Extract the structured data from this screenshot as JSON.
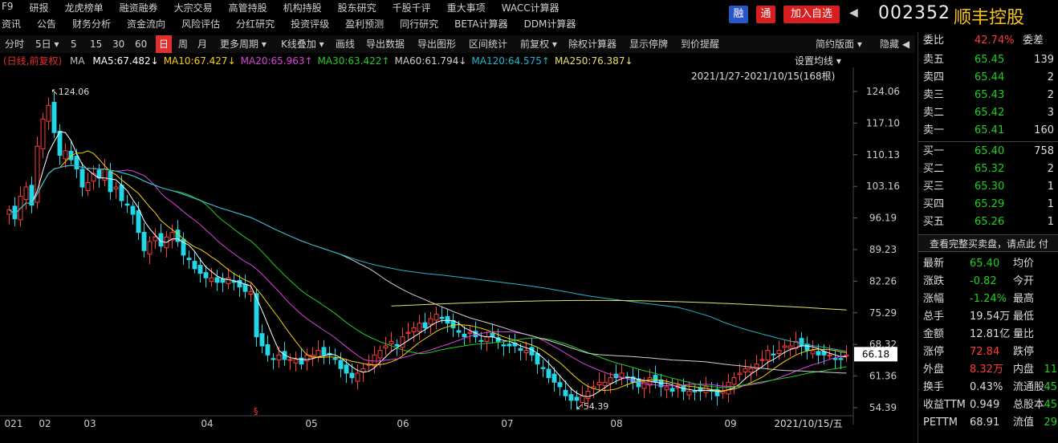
{
  "topnav": {
    "row1": [
      "F9",
      "研报",
      "龙虎榜单",
      "融资融券",
      "大宗交易",
      "高管持股",
      "机构持股",
      "股东研究",
      "千股千评",
      "重大事项",
      "WACC计算器"
    ],
    "row2": [
      "资讯",
      "公告",
      "财务分析",
      "资金流向",
      "风险评估",
      "分红研究",
      "投资评级",
      "盈利预测",
      "同行研究",
      "BETA计算器",
      "DDM计算器"
    ]
  },
  "header": {
    "btn_rong": "融",
    "btn_tong": "通",
    "btn_add": "加入自选",
    "arrow": "◀",
    "code": "002352",
    "name": "顺丰控股",
    "colors": {
      "rong": "#2a55c8",
      "tong": "#d81e1e",
      "add": "#d81e1e",
      "name": "#f5c518"
    }
  },
  "toolbar": {
    "items": [
      "分时",
      "5日 ▾",
      "5",
      "15",
      "30",
      "60",
      "日",
      "周",
      "月",
      "更多周期 ▾",
      "K线叠加 ▾",
      "画线",
      "导出数据",
      "导出图形",
      "区间统计",
      "前复权 ▾",
      "除权计算器",
      "显示停牌",
      "到价提醒",
      "简约版面 ▾",
      "隐藏 ◀"
    ],
    "active": "日"
  },
  "ma_legend": {
    "label": "(日线,前复权)",
    "ma": "MA",
    "items": [
      {
        "text": "MA5:67.482↓",
        "color": "#ffffff"
      },
      {
        "text": "MA10:67.427↓",
        "color": "#f5d200"
      },
      {
        "text": "MA20:65.963↑",
        "color": "#e040e0"
      },
      {
        "text": "MA30:63.422↑",
        "color": "#22cc22"
      },
      {
        "text": "MA60:61.794↓",
        "color": "#d0d0d0"
      },
      {
        "text": "MA120:64.575↑",
        "color": "#21b5d0"
      },
      {
        "text": "MA250:76.387↓",
        "color": "#e8e070"
      }
    ],
    "setting": "设置均线 ▾",
    "range": "2021/1/27-2021/10/15(168根)"
  },
  "chart_data": {
    "type": "candlestick",
    "yaxis_ticks": [
      "124.06",
      "117.10",
      "110.13",
      "103.16",
      "96.19",
      "89.23",
      "82.26",
      "75.29",
      "68.32",
      "61.36",
      "54.39"
    ],
    "ylim": [
      54.39,
      124.06
    ],
    "current_price_label": "66.18",
    "xaxis_labels": [
      "021",
      "02",
      "03",
      "04",
      "05",
      "06",
      "07",
      "08",
      "09",
      "2021/10/15/五"
    ],
    "high_label": "124.06",
    "low_label": "54.39",
    "closes": [
      98,
      96,
      101,
      103,
      99,
      112,
      118,
      121,
      115,
      110,
      111,
      109,
      107,
      103,
      104,
      106,
      105,
      107,
      102,
      103,
      100,
      99,
      97,
      93,
      89,
      91,
      92,
      90,
      92,
      93,
      91,
      88,
      87,
      85,
      84,
      83,
      83,
      82,
      82,
      83,
      82,
      81,
      80,
      80,
      70,
      68,
      66,
      65,
      66,
      65,
      65,
      65,
      64,
      66,
      66,
      67,
      66,
      66,
      65,
      63,
      62,
      61,
      62,
      63,
      64,
      66,
      67,
      68,
      69,
      68,
      70,
      71,
      72,
      73,
      72,
      74,
      75,
      74,
      73,
      72,
      71,
      70,
      71,
      70,
      69,
      70,
      70,
      69,
      68,
      68,
      68,
      67,
      67,
      66,
      64,
      63,
      61,
      60,
      59,
      57,
      56,
      56,
      57,
      58,
      59,
      60,
      60,
      61,
      61,
      62,
      61,
      60,
      59,
      60,
      61,
      60,
      59,
      59,
      58,
      59,
      58,
      58,
      58,
      58,
      59,
      58,
      57,
      58,
      60,
      61,
      62,
      63,
      63,
      64,
      65,
      67,
      66,
      67,
      68,
      68,
      69,
      68,
      67,
      67,
      66,
      66,
      66,
      65,
      65,
      66
    ],
    "marker_symbol": "§"
  },
  "order_book": {
    "weibi_label": "委比",
    "weibi_value": "42.74%",
    "weicha_label": "委差",
    "sells": [
      {
        "label": "卖五",
        "price": "65.45",
        "vol": "139"
      },
      {
        "label": "卖四",
        "price": "65.44",
        "vol": "2"
      },
      {
        "label": "卖三",
        "price": "65.43",
        "vol": "2"
      },
      {
        "label": "卖二",
        "price": "65.42",
        "vol": "3"
      },
      {
        "label": "卖一",
        "price": "65.41",
        "vol": "160"
      }
    ],
    "buys": [
      {
        "label": "买一",
        "price": "65.40",
        "vol": "758"
      },
      {
        "label": "买二",
        "price": "65.32",
        "vol": "2"
      },
      {
        "label": "买三",
        "price": "65.30",
        "vol": "1"
      },
      {
        "label": "买四",
        "price": "65.29",
        "vol": "1"
      },
      {
        "label": "买五",
        "price": "65.26",
        "vol": "1"
      }
    ],
    "full_book_link": "查看完整买卖盘，请点此 付"
  },
  "quote": {
    "rows": [
      {
        "l1": "最新",
        "v1": "65.40",
        "c1": "green",
        "l2": "均价",
        "v2": ""
      },
      {
        "l1": "涨跌",
        "v1": "-0.82",
        "c1": "green",
        "l2": "今开",
        "v2": ""
      },
      {
        "l1": "涨幅",
        "v1": "-1.24%",
        "c1": "green",
        "l2": "最高",
        "v2": ""
      },
      {
        "l1": "总手",
        "v1": "19.54万",
        "c1": "white",
        "l2": "最低",
        "v2": ""
      },
      {
        "l1": "金额",
        "v1": "12.81亿",
        "c1": "white",
        "l2": "量比",
        "v2": ""
      },
      {
        "l1": "涨停",
        "v1": "72.84",
        "c1": "red",
        "l2": "跌停",
        "v2": ""
      },
      {
        "l1": "外盘",
        "v1": "8.32万",
        "c1": "red",
        "l2": "内盘",
        "v2": "11"
      },
      {
        "l1": "换手",
        "v1": "0.43%",
        "c1": "white",
        "l2": "流通股",
        "v2": "45"
      },
      {
        "l1": "收益TTM",
        "v1": "0.949",
        "c1": "white",
        "l2": "总股本",
        "v2": "45"
      },
      {
        "l1": "PETTM",
        "v1": "68.91",
        "c1": "white",
        "l2": "流值",
        "v2": "29"
      }
    ]
  }
}
